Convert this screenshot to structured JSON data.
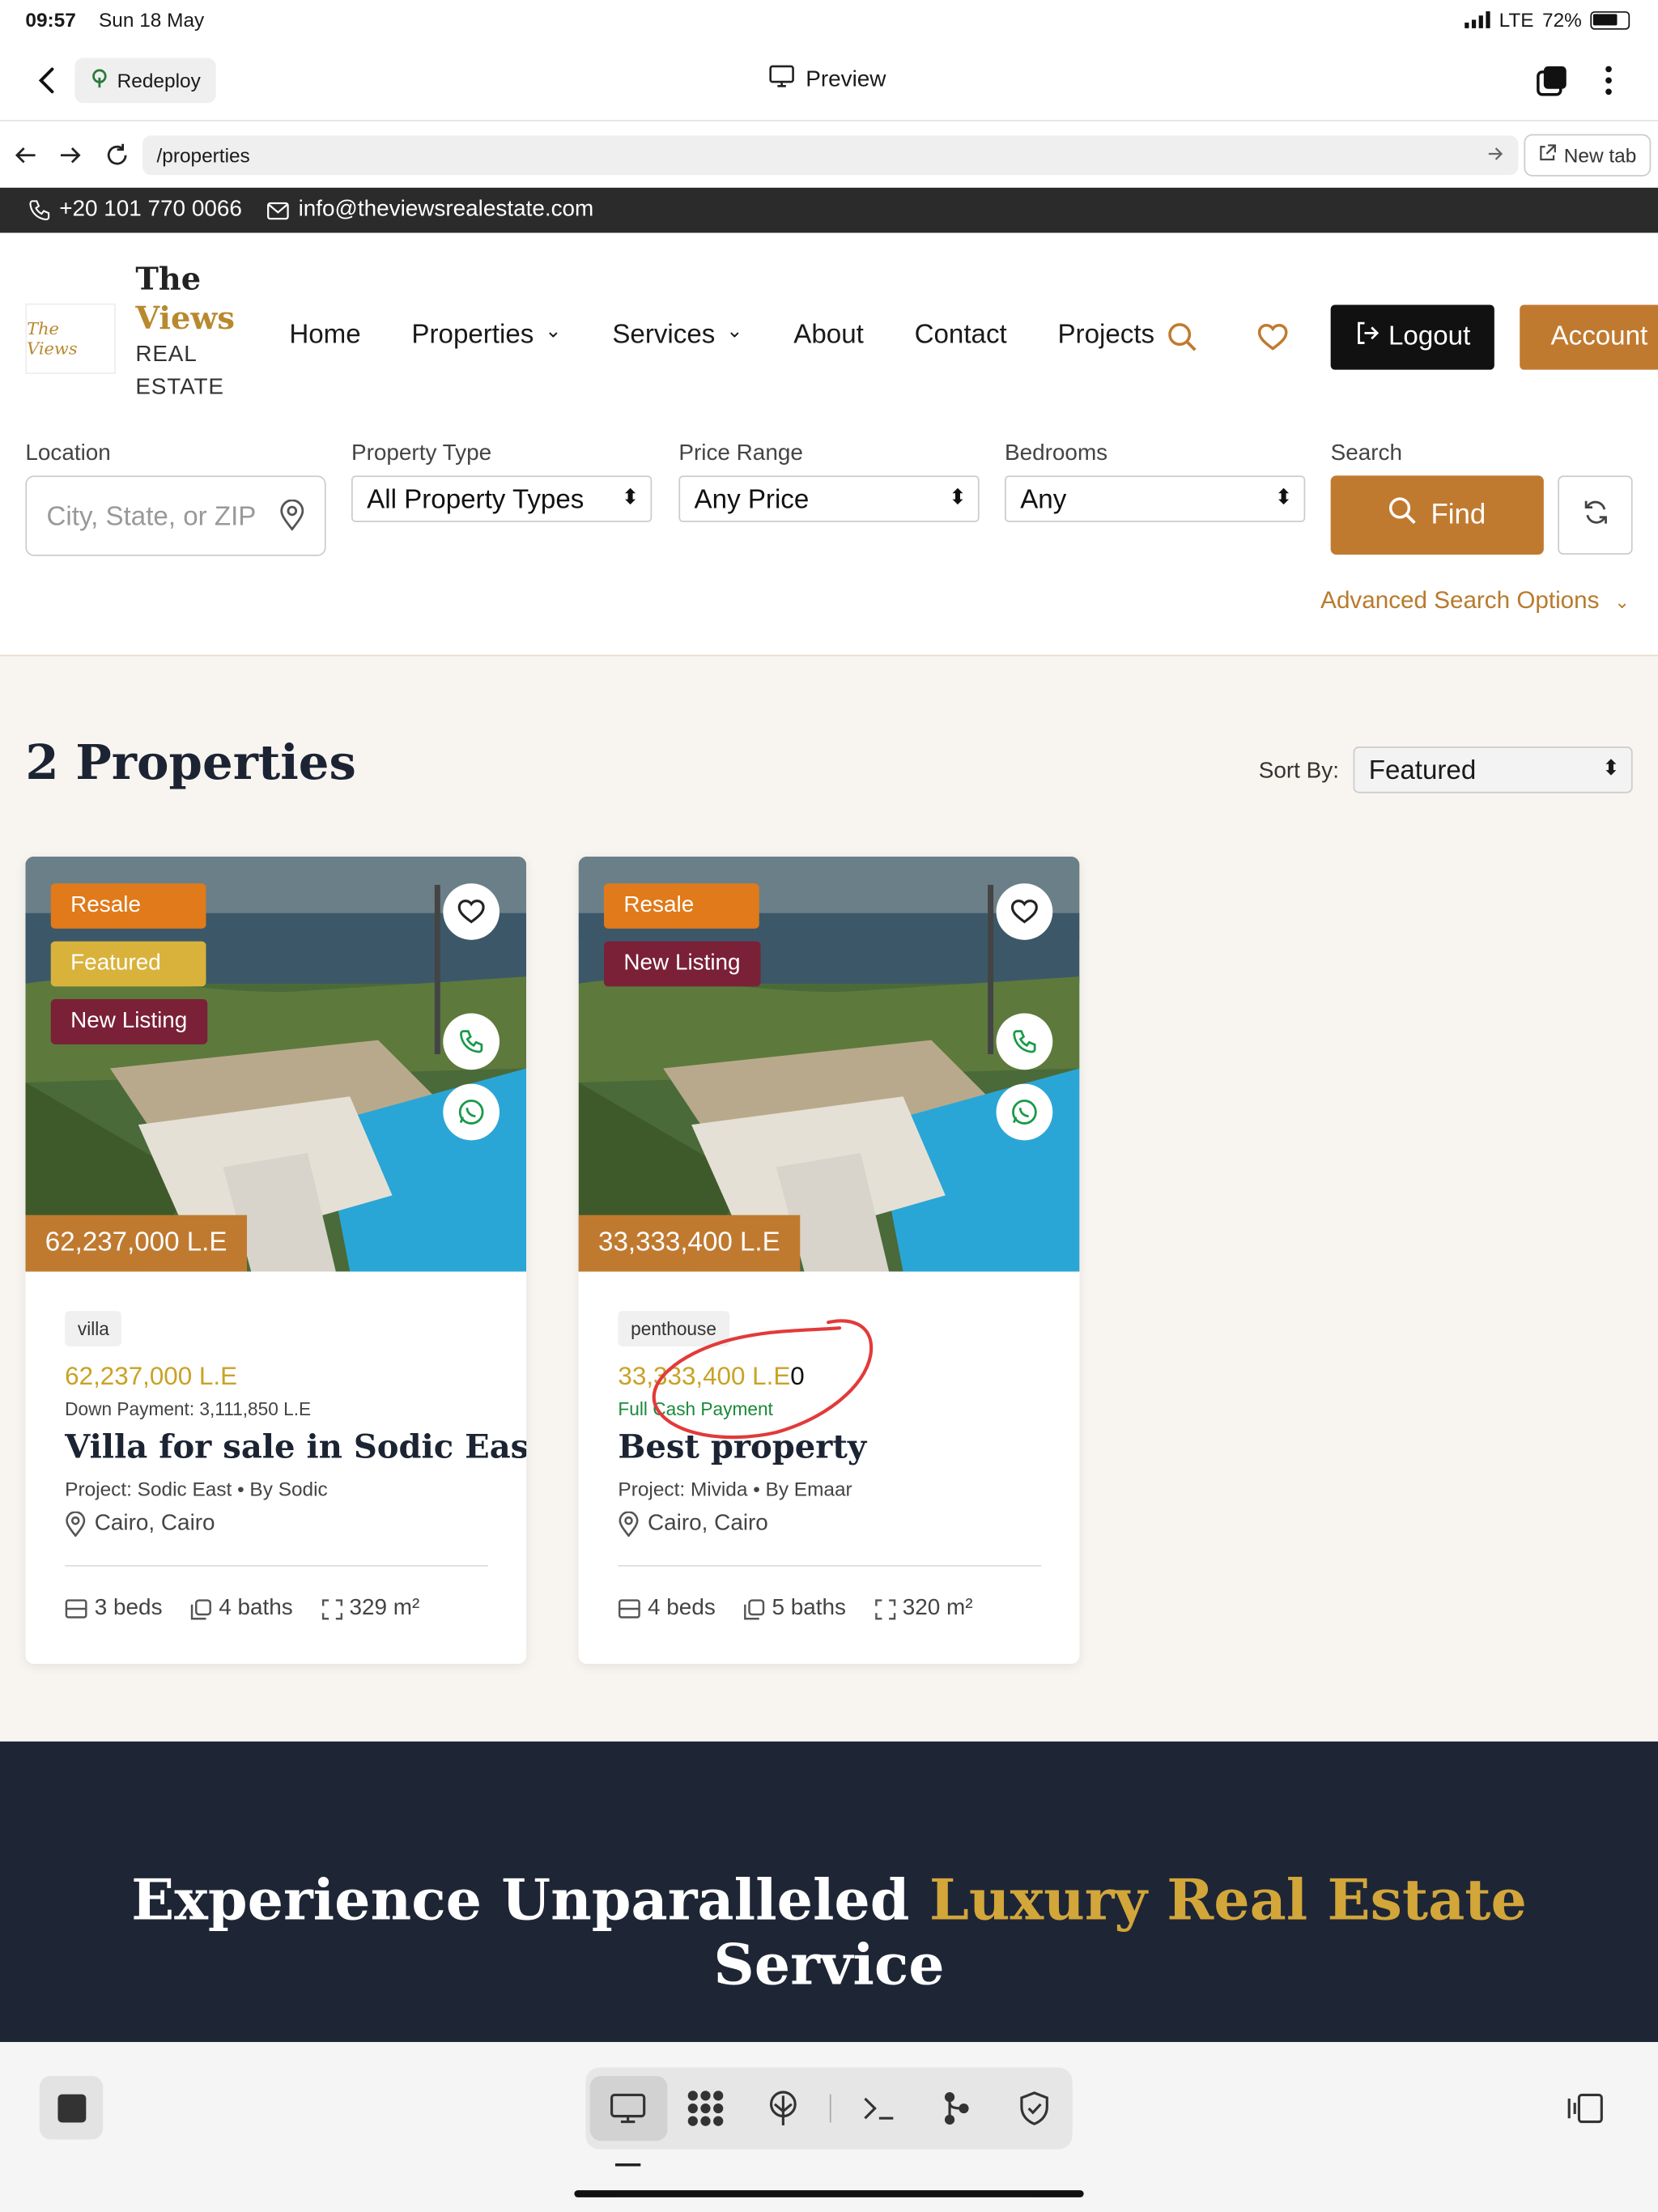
{
  "status": {
    "time": "09:57",
    "date": "Sun 18 May",
    "network": "LTE",
    "battery": "72%"
  },
  "appbar": {
    "redeploy_label": "Redeploy",
    "preview_label": "Preview"
  },
  "browser": {
    "url": "/properties",
    "newtab_label": "New tab"
  },
  "topinfo": {
    "phone": "+20 101 770 0066",
    "email": "info@theviewsrealestate.com"
  },
  "brand": {
    "line1": "The",
    "line2": "Views",
    "line3": "REAL",
    "line4": "ESTATE",
    "logo_text": "The Views"
  },
  "nav": {
    "home": "Home",
    "properties": "Properties",
    "services": "Services",
    "about": "About",
    "contact": "Contact",
    "projects": "Projects",
    "logout": "Logout",
    "account": "Account"
  },
  "filters": {
    "location_label": "Location",
    "location_placeholder": "City, State, or ZIP",
    "type_label": "Property Type",
    "type_value": "All Property Types",
    "price_label": "Price Range",
    "price_value": "Any Price",
    "beds_label": "Bedrooms",
    "beds_value": "Any",
    "search_label": "Search",
    "find_label": "Find",
    "advanced_label": "Advanced Search Options"
  },
  "results": {
    "title": "2 Properties",
    "sort_label": "Sort By:",
    "sort_value": "Featured"
  },
  "cards": [
    {
      "tags": [
        "Resale",
        "Featured",
        "New Listing"
      ],
      "ribbon_price": "62,237,000 L.E",
      "type": "villa",
      "price": "62,237,000 L.E",
      "sub": "Down Payment: 3,111,850 L.E",
      "title": "Villa for sale in Sodic East",
      "project": "Project: Sodic East • By Sodic",
      "location": "Cairo, Cairo",
      "beds": "3 beds",
      "baths": "4 baths",
      "area": "329 m²"
    },
    {
      "tags": [
        "Resale",
        "New Listing"
      ],
      "ribbon_price": "33,333,400 L.E",
      "type": "penthouse",
      "price": "33,333,400 L.E",
      "price_suffix": "0",
      "sub": "Full Cash Payment",
      "title": "Best property",
      "project": "Project: Mivida • By Emaar",
      "location": "Cairo, Cairo",
      "beds": "4 beds",
      "baths": "5 baths",
      "area": "320 m²"
    }
  ],
  "cta": {
    "heading_part1": "Experience Unparalleled ",
    "heading_gold": "Luxury Real Estate",
    "heading_part2": "Service"
  },
  "colors": {
    "accent": "#c07a30",
    "gold": "#c9a227",
    "dark": "#1e2636",
    "tag_resale": "#e07a1a",
    "tag_featured": "#d9b23c",
    "tag_new": "#7a2037"
  }
}
